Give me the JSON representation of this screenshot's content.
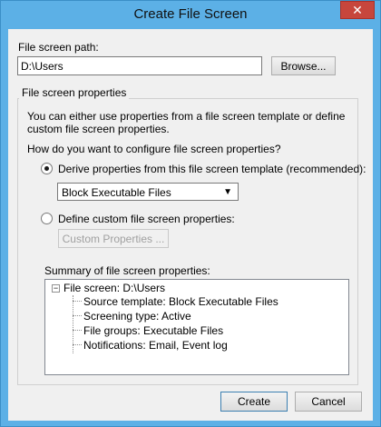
{
  "window": {
    "title": "Create File Screen",
    "close_symbol": "✕"
  },
  "path": {
    "label": "File screen path:",
    "value": "D:\\Users",
    "browse_label": "Browse..."
  },
  "properties": {
    "group_title": "File screen properties",
    "description": "You can either use properties from a file screen template or define custom file screen properties.",
    "question": "How do you want to configure file screen properties?",
    "derive_option": "Derive properties from this file screen template (recommended):",
    "template_selected": "Block Executable Files",
    "custom_option": "Define custom file screen properties:",
    "custom_button_label": "Custom Properties ..."
  },
  "summary": {
    "label": "Summary of file screen properties:",
    "root": "File screen: D:\\Users",
    "expander_symbol": "−",
    "children": [
      "Source template: Block Executable Files",
      "Screening type: Active",
      "File groups: Executable Files",
      "Notifications: Email, Event log"
    ]
  },
  "footer": {
    "create_label": "Create",
    "cancel_label": "Cancel"
  },
  "icons": {
    "close": "close-icon",
    "dropdown": "chevron-down-icon",
    "expander": "collapse-icon"
  }
}
